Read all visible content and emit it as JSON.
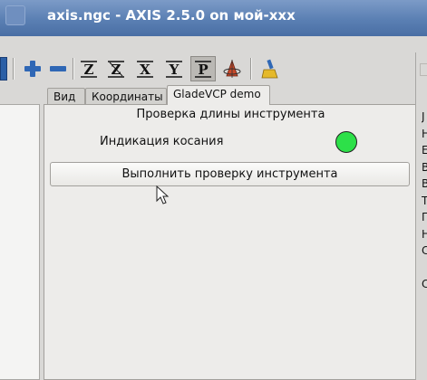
{
  "window": {
    "title": "axis.ngc - AXIS 2.5.0 on мой-xxx"
  },
  "toolbar": {
    "buttons": [
      {
        "icon": "zoom-in-icon"
      },
      {
        "icon": "zoom-out-icon"
      },
      {
        "icon": "view-z-icon",
        "label": "Z"
      },
      {
        "icon": "view-z2-icon",
        "label": "Z"
      },
      {
        "icon": "view-x-icon",
        "label": "X"
      },
      {
        "icon": "view-y-icon",
        "label": "Y"
      },
      {
        "icon": "view-p-icon",
        "label": "P",
        "active": true
      },
      {
        "icon": "rotate-view-icon"
      },
      {
        "icon": "clear-plot-icon"
      }
    ]
  },
  "tabs": [
    {
      "label": "Вид"
    },
    {
      "label": "Координаты"
    },
    {
      "label": "GladeVCP demo",
      "active": true
    }
  ],
  "gladevcp": {
    "frame_title": "Проверка длины инструмента",
    "touch_label": "Индикация косания",
    "touch_led_color": "#2de049",
    "run_button_label": "Выполнить проверку инструмента"
  },
  "right_panel": {
    "letters": [
      "J",
      "Н",
      "E",
      "В",
      "В",
      "Т",
      "П",
      "Н",
      "С",
      "",
      "С"
    ]
  },
  "colors": {
    "titlebar": "#5a7fb3",
    "background": "#d9d8d6",
    "notebook": "#edecea"
  }
}
